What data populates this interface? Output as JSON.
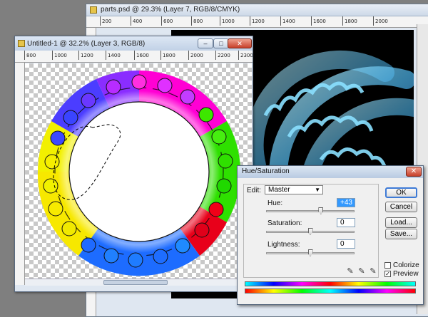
{
  "back_window": {
    "title": "parts.psd @ 29.3% (Layer 7, RGB/8/CMYK)",
    "ruler_labels": [
      "200",
      "400",
      "600",
      "800",
      "1000",
      "1200",
      "1400",
      "1600",
      "1800",
      "2000"
    ]
  },
  "front_window": {
    "title": "Untitled-1 @ 32.2% (Layer 3, RGB/8)",
    "ruler_labels": [
      "800",
      "1000",
      "1200",
      "1400",
      "1600",
      "1800",
      "2000",
      "2200",
      "2300"
    ],
    "buttons": {
      "minimize": "–",
      "maximize": "□",
      "close": "✕"
    }
  },
  "hue_saturation": {
    "title": "Hue/Saturation",
    "edit_label": "Edit:",
    "edit_value": "Master",
    "hue_label": "Hue:",
    "hue_value": "+43",
    "saturation_label": "Saturation:",
    "saturation_value": "0",
    "lightness_label": "Lightness:",
    "lightness_value": "0",
    "ok_label": "OK",
    "cancel_label": "Cancel",
    "load_label": "Load...",
    "save_label": "Save...",
    "colorize_label": "Colorize",
    "colorize_checked": false,
    "preview_label": "Preview",
    "preview_checked": true,
    "close_glyph": "✕",
    "hue_fraction": 0.62,
    "saturation_fraction": 0.5,
    "lightness_fraction": 0.5
  },
  "colors": {
    "canvas_bg": "#000000",
    "accent_blue": "#3d7ad6"
  }
}
